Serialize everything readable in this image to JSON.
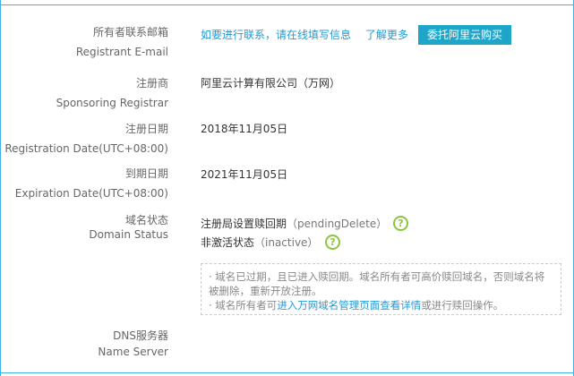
{
  "registrant_email": {
    "label_zh": "所有者联系邮箱",
    "label_en": "Registrant E-mail",
    "contact_link": "如要进行联系，请在线填写信息",
    "learn_more_link": "了解更多",
    "buy_button": "委托阿里云购买"
  },
  "registrar": {
    "label_zh": "注册商",
    "label_en": "Sponsoring Registrar",
    "value": "阿里云计算有限公司（万网）"
  },
  "registration_date": {
    "label_zh": "注册日期",
    "label_en": "Registration Date(UTC+08:00)",
    "value": "2018年11月05日"
  },
  "expiration_date": {
    "label_zh": "到期日期",
    "label_en": "Expiration Date(UTC+08:00)",
    "value": "2021年11月05日"
  },
  "domain_status": {
    "label_zh": "域名状态",
    "label_en": "Domain Status",
    "statuses": [
      {
        "name": "注册局设置赎回期",
        "code": "（pendingDelete）"
      },
      {
        "name": "非激活状态",
        "code": "（inactive）"
      }
    ],
    "help_icon": "help-question-icon"
  },
  "notice": {
    "line1": "· 域名已过期，且已进入赎回期。域名所有者可高价赎回域名，否则域名将被删除，重新开放注册。",
    "line2_prefix": "· 域名所有者可",
    "line2_link": "进入万网域名管理页面查看详情",
    "line2_suffix": "或进行赎回操作。"
  },
  "name_server": {
    "label_zh": "DNS服务器",
    "label_en": "Name Server"
  },
  "colors": {
    "accent": "#1fa5c8",
    "link": "#1f9ad6",
    "help_green": "#8cc63f",
    "frame_blue": "#42b2e5"
  }
}
